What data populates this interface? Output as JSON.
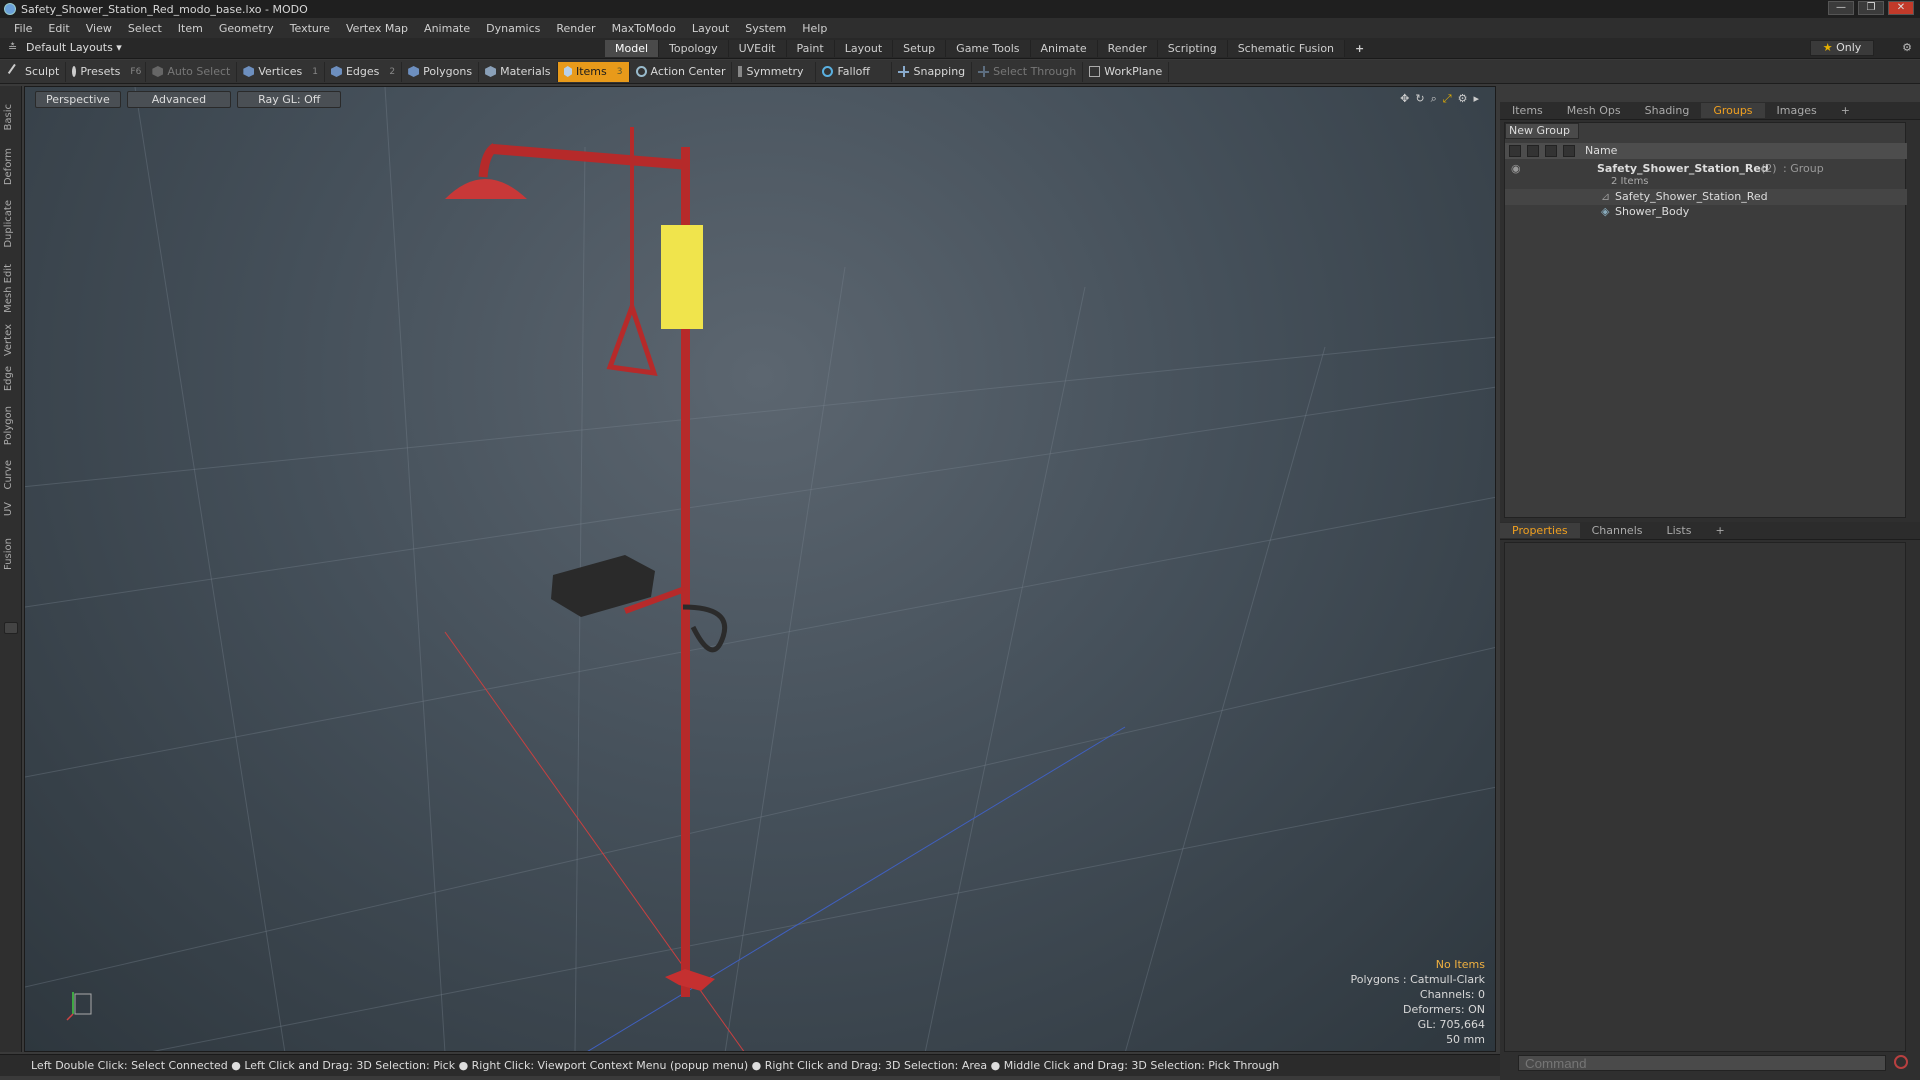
{
  "window": {
    "title": "Safety_Shower_Station_Red_modo_base.lxo - MODO",
    "controls": [
      "—",
      "❐",
      "✕"
    ]
  },
  "menu": [
    "File",
    "Edit",
    "View",
    "Select",
    "Item",
    "Geometry",
    "Texture",
    "Vertex Map",
    "Animate",
    "Dynamics",
    "Render",
    "MaxToModo",
    "Layout",
    "System",
    "Help"
  ],
  "layout_bar": {
    "layout_select": "Default Layouts ▾",
    "tabs": [
      "Model",
      "Topology",
      "UVEdit",
      "Paint",
      "Layout",
      "Setup",
      "Game Tools",
      "Animate",
      "Render",
      "Scripting",
      "Schematic Fusion"
    ],
    "active_tab": "Model",
    "add_tab": "+",
    "only_label": "Only"
  },
  "toolbar": {
    "sculpt": "Sculpt",
    "presets": "Presets",
    "presets_hotkey": "F6",
    "auto_select": "Auto Select",
    "vertices": "Vertices",
    "vertices_count": "1",
    "edges": "Edges",
    "edges_count": "2",
    "polygons": "Polygons",
    "materials": "Materials",
    "items": "Items",
    "items_count": "3",
    "action_center": "Action Center",
    "symmetry": "Symmetry",
    "falloff": "Falloff",
    "snapping": "Snapping",
    "select_through": "Select Through",
    "workplane": "WorkPlane"
  },
  "left_tabs": [
    "Basic",
    "Deform",
    "Duplicate",
    "Mesh Edit",
    "Vertex",
    "Edge",
    "Polygon",
    "Curve",
    "UV",
    "Fusion"
  ],
  "viewport": {
    "view_mode": "Perspective",
    "shading": "Advanced",
    "raygl": "Ray GL: Off",
    "stats": {
      "selection": "No Items",
      "polygons": "Polygons : Catmull-Clark",
      "channels": "Channels: 0",
      "deformers": "Deformers: ON",
      "gl": "GL: 705,664",
      "scale": "50 mm"
    }
  },
  "status_bar": "Left Double Click: Select Connected ● Left Click and Drag: 3D Selection: Pick ● Right Click: Viewport Context Menu (popup menu) ● Right Click and Drag: 3D Selection: Area ● Middle Click and Drag: 3D Selection: Pick Through",
  "right_panel": {
    "top_tabs": [
      "Items",
      "Mesh Ops",
      "Shading",
      "Groups",
      "Images"
    ],
    "active_top_tab": "Groups",
    "new_group": "New Group",
    "name_header": "Name",
    "group": {
      "name": "Safety_Shower_Station_Red",
      "count": "(2)",
      "type": ": Group",
      "sub": "2 Items"
    },
    "children": [
      "Safety_Shower_Station_Red",
      "Shower_Body"
    ],
    "bottom_tabs": [
      "Properties",
      "Channels",
      "Lists"
    ],
    "active_bottom_tab": "Properties",
    "command_placeholder": "Command"
  }
}
